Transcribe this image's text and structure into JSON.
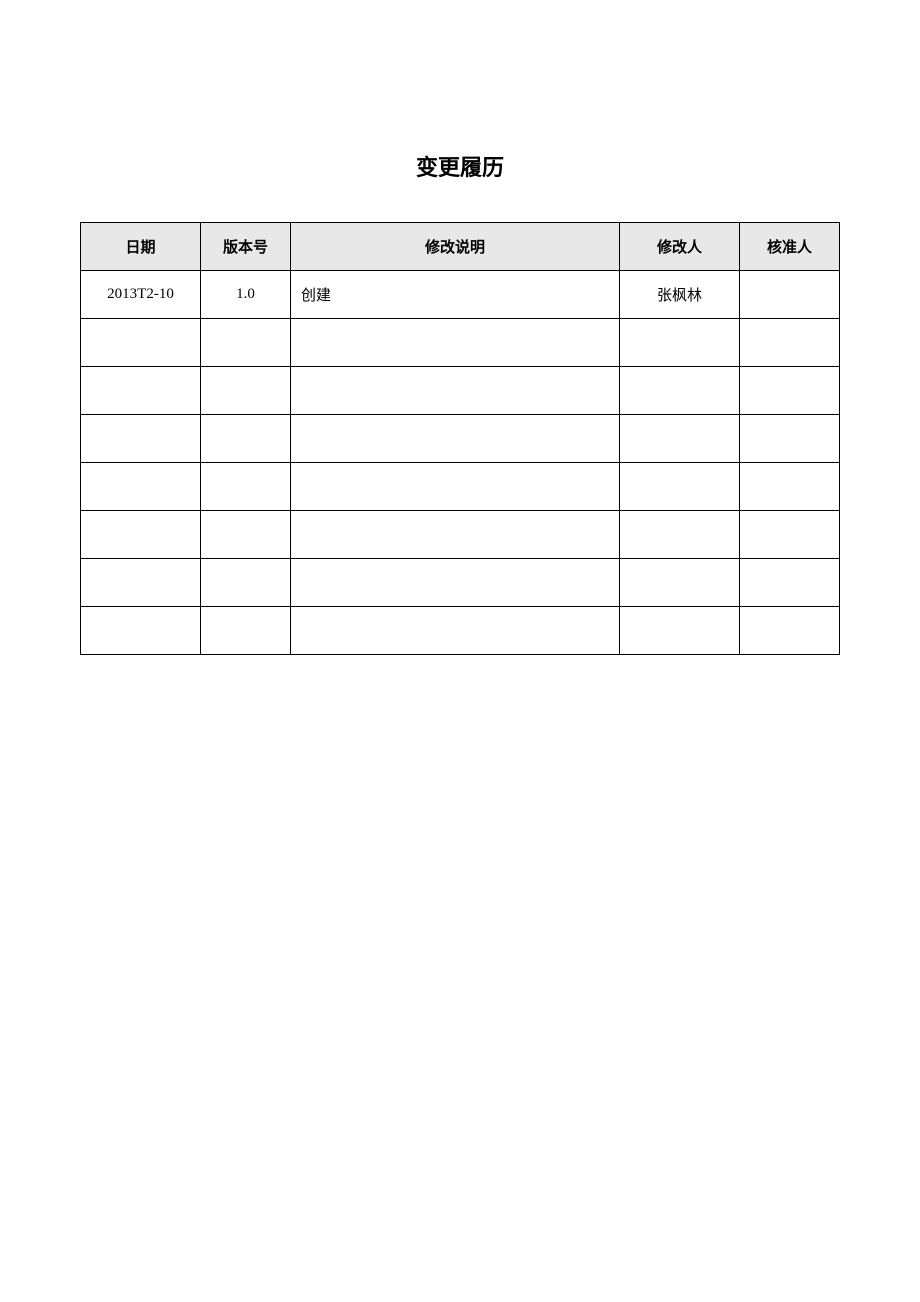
{
  "title": "变更履历",
  "headers": {
    "date": "日期",
    "version": "版本号",
    "description": "修改说明",
    "modifier": "修改人",
    "approver": "核准人"
  },
  "rows": [
    {
      "date": "2013T2-10",
      "version": "1.0",
      "description": "创建",
      "modifier": "张枫林",
      "approver": ""
    },
    {
      "date": "",
      "version": "",
      "description": "",
      "modifier": "",
      "approver": ""
    },
    {
      "date": "",
      "version": "",
      "description": "",
      "modifier": "",
      "approver": ""
    },
    {
      "date": "",
      "version": "",
      "description": "",
      "modifier": "",
      "approver": ""
    },
    {
      "date": "",
      "version": "",
      "description": "",
      "modifier": "",
      "approver": ""
    },
    {
      "date": "",
      "version": "",
      "description": "",
      "modifier": "",
      "approver": ""
    },
    {
      "date": "",
      "version": "",
      "description": "",
      "modifier": "",
      "approver": ""
    },
    {
      "date": "",
      "version": "",
      "description": "",
      "modifier": "",
      "approver": ""
    }
  ]
}
